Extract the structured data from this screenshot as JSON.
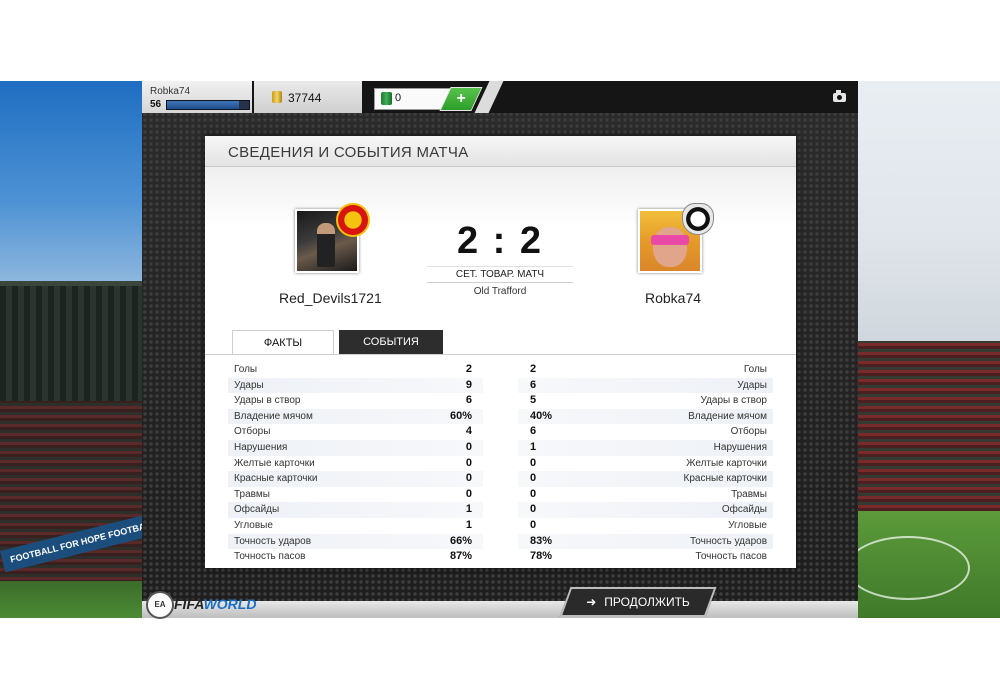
{
  "topbar": {
    "username": "Robka74",
    "level": "56",
    "xp_fraction": 0.88,
    "coins": "37744",
    "points": "0",
    "add_label": "+"
  },
  "panel": {
    "title": "СВЕДЕНИЯ И СОБЫТИЯ МАТЧА",
    "home_team": "Red_Devils1721",
    "away_team": "Robka74",
    "score": "2 : 2",
    "match_type": "СЕТ. ТОВАР. МАТЧ",
    "venue": "Old Trafford",
    "tabs": [
      "ФАКТЫ",
      "СОБЫТИЯ"
    ]
  },
  "stats": [
    {
      "label": "Голы",
      "home": "2",
      "away": "2"
    },
    {
      "label": "Удары",
      "home": "9",
      "away": "6"
    },
    {
      "label": "Удары в створ",
      "home": "6",
      "away": "5"
    },
    {
      "label": "Владение мячом",
      "home": "60%",
      "away": "40%"
    },
    {
      "label": "Отборы",
      "home": "4",
      "away": "6"
    },
    {
      "label": "Нарушения",
      "home": "0",
      "away": "1"
    },
    {
      "label": "Желтые карточки",
      "home": "0",
      "away": "0"
    },
    {
      "label": "Красные карточки",
      "home": "0",
      "away": "0"
    },
    {
      "label": "Травмы",
      "home": "0",
      "away": "0"
    },
    {
      "label": "Офсайды",
      "home": "1",
      "away": "0"
    },
    {
      "label": "Угловые",
      "home": "1",
      "away": "0"
    },
    {
      "label": "Точность ударов",
      "home": "66%",
      "away": "83%"
    },
    {
      "label": "Точность пасов",
      "home": "87%",
      "away": "78%"
    }
  ],
  "footer": {
    "continue_label": "ПРОДОЛЖИТЬ",
    "logo_ea": "EA",
    "logo_fifa": "FIFA",
    "logo_world": "WORLD",
    "banner_text": "FOOTBALL FOR HOPE  FOOTBALL FOR HOPE"
  },
  "icons": {
    "coin": "coin-icon",
    "points": "points-icon",
    "camera": "camera-icon",
    "arrow": "arrow-right-icon"
  }
}
